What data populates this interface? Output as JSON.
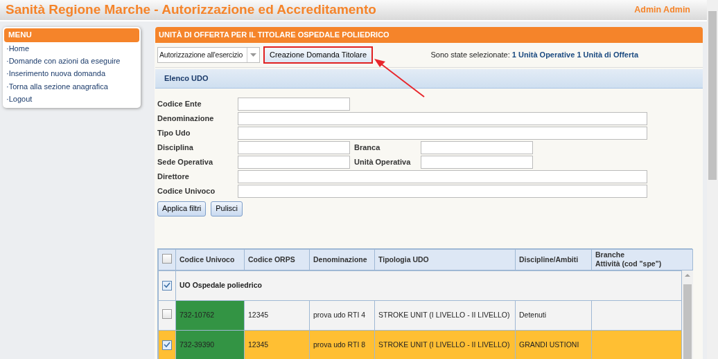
{
  "header": {
    "title": "Sanità Regione Marche - Autorizzazione ed Accreditamento",
    "user": "Admin Admin"
  },
  "menu": {
    "title": "MENU",
    "items": [
      "·Home",
      "·Domande con azioni da eseguire",
      "·Inserimento nuova domanda",
      "·Torna alla sezione anagrafica",
      "·Logout"
    ]
  },
  "panel": {
    "title": "UNITÀ DI OFFERTA PER IL TITOLARE OSPEDALE POLIEDRICO",
    "select": {
      "value": "Autorizzazione all'esercizio"
    },
    "action_button": "Creazione Domanda Titolare",
    "selection": {
      "label": "Sono state selezionate:",
      "value": "1 Unità Operative 1 Unità di Offerta"
    }
  },
  "section": {
    "title": "Elenco UDO"
  },
  "filter_rows": [
    {
      "kind": "short",
      "fields": [
        "Codice Ente"
      ]
    },
    {
      "kind": "wide",
      "fields": [
        "Denominazione"
      ]
    },
    {
      "kind": "wide",
      "fields": [
        "Tipo Udo"
      ]
    },
    {
      "kind": "pair",
      "fields": [
        "Disciplina",
        "Branca"
      ]
    },
    {
      "kind": "pair",
      "fields": [
        "Sede Operativa",
        "Unità Operativa"
      ]
    },
    {
      "kind": "wide",
      "fields": [
        "Direttore"
      ]
    },
    {
      "kind": "wide",
      "fields": [
        "Codice Univoco"
      ]
    }
  ],
  "filter_buttons": [
    "Applica filtri",
    "Pulisci"
  ],
  "table": {
    "header_checked": false,
    "columns": [
      "Codice Univoco",
      "Codice ORPS",
      "Denominazione",
      "Tipologia UDO",
      "Discipline/Ambiti",
      "Branche\nAttività (cod \"spe\")"
    ],
    "group": {
      "label": "UO Ospedale poliedrico",
      "checked": true
    },
    "rows": [
      {
        "checked": false,
        "selected": false,
        "color": "#339444",
        "cells": [
          "732-10762",
          "12345",
          "prova udo RTI 4",
          "STROKE UNIT (I LIVELLO - II LIVELLO)",
          "Detenuti"
        ]
      },
      {
        "checked": true,
        "selected": true,
        "color": "#339444",
        "cells": [
          "732-39390",
          "12345",
          "prova udo RTI 8",
          "STROKE UNIT (I LIVELLO - II LIVELLO)",
          "GRANDI USTIONI"
        ]
      }
    ]
  }
}
